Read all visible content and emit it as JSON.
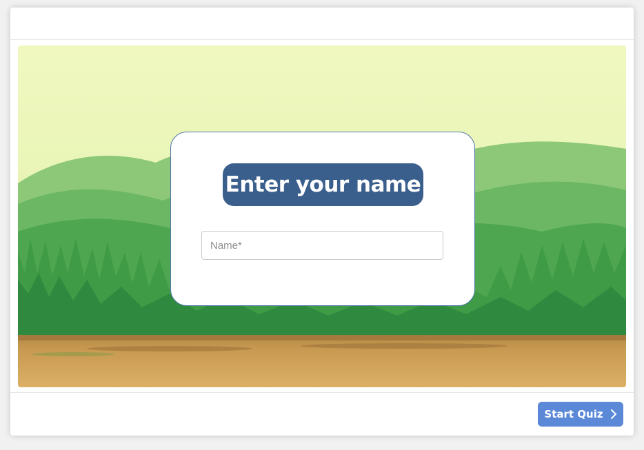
{
  "dialog": {
    "title": "Enter your name",
    "name_input": {
      "placeholder": "Name*",
      "value": ""
    }
  },
  "footer": {
    "start_button": {
      "label": "Start Quiz",
      "icon": "chevron-right-icon"
    }
  },
  "colors": {
    "title_bg": "#3a5f8c",
    "button_bg": "#5b88d7",
    "dialog_border": "#4f78a8"
  }
}
